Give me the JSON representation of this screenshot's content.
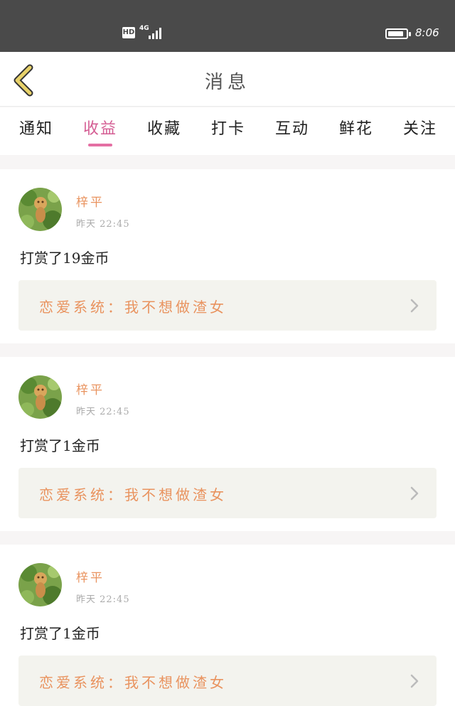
{
  "status_bar": {
    "hd": "HD",
    "network": "4G",
    "time": "8:06",
    "battery_level": 0.9
  },
  "nav": {
    "title": "消息",
    "back_icon": "chevron-left-icon"
  },
  "tabs": [
    {
      "label": "通知",
      "active": false
    },
    {
      "label": "收益",
      "active": true
    },
    {
      "label": "收藏",
      "active": false
    },
    {
      "label": "打卡",
      "active": false
    },
    {
      "label": "互动",
      "active": false
    },
    {
      "label": "鲜花",
      "active": false
    },
    {
      "label": "关注",
      "active": false
    }
  ],
  "messages": [
    {
      "user": "梓平",
      "time": "昨天  22:45",
      "text": "打赏了19金币",
      "book": "恋爱系统：我不想做渣女"
    },
    {
      "user": "梓平",
      "time": "昨天  22:45",
      "text": "打赏了1金币",
      "book": "恋爱系统：我不想做渣女"
    },
    {
      "user": "梓平",
      "time": "昨天  22:45",
      "text": "打赏了1金币",
      "book": "恋爱系统：我不想做渣女"
    }
  ],
  "colors": {
    "accent_pink": "#d45d93",
    "orange_text": "#e9935f",
    "status_bar_bg": "#4a4a4a",
    "back_icon": "#e8d26a"
  }
}
